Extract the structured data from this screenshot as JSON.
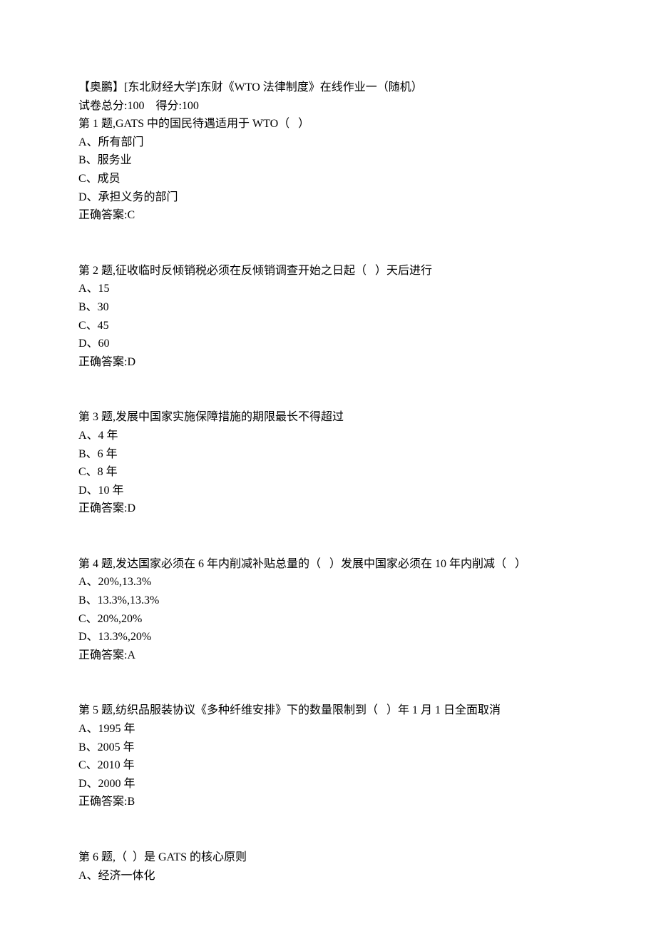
{
  "header": {
    "title": "【奥鹏】[东北财经大学]东财《WTO 法律制度》在线作业一（随机）",
    "scoreline": "试卷总分:100    得分:100"
  },
  "questions": [
    {
      "prompt": "第 1 题,GATS 中的国民待遇适用于 WTO（   ）",
      "opts": [
        "A、所有部门",
        "B、服务业",
        "C、成员",
        "D、承担义务的部门"
      ],
      "ans": "正确答案:C"
    },
    {
      "prompt": "第 2 题,征收临时反倾销税必须在反倾销调查开始之日起（   ）天后进行",
      "opts": [
        "A、15",
        "B、30",
        "C、45",
        "D、60"
      ],
      "ans": "正确答案:D"
    },
    {
      "prompt": "第 3 题,发展中国家实施保障措施的期限最长不得超过",
      "opts": [
        "A、4 年",
        "B、6 年",
        "C、8 年",
        "D、10 年"
      ],
      "ans": "正确答案:D"
    },
    {
      "prompt": "第 4 题,发达国家必须在 6 年内削减补贴总量的（   ）发展中国家必须在 10 年内削减（   ）",
      "opts": [
        "A、20%,13.3%",
        "B、13.3%,13.3%",
        "C、20%,20%",
        "D、13.3%,20%"
      ],
      "ans": "正确答案:A"
    },
    {
      "prompt": "第 5 题,纺织品服装协议《多种纤维安排》下的数量限制到（   ）年 1 月 1 日全面取消",
      "opts": [
        "A、1995 年",
        "B、2005 年",
        "C、2010 年",
        "D、2000 年"
      ],
      "ans": "正确答案:B"
    },
    {
      "prompt": "第 6 题,（  ）是 GATS 的核心原则",
      "opts": [
        "A、经济一体化"
      ],
      "ans": ""
    }
  ]
}
